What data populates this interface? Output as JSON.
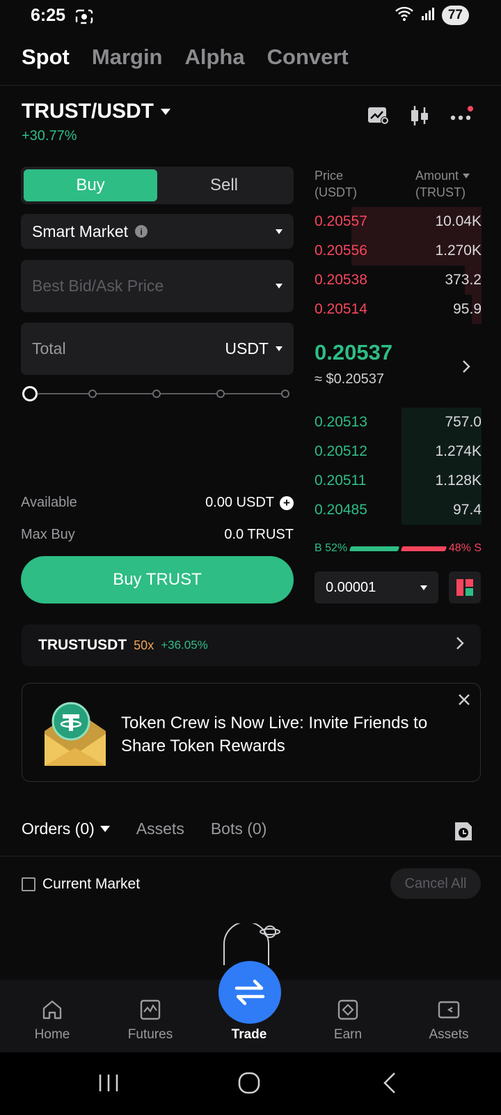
{
  "status": {
    "time": "6:25",
    "battery": "77"
  },
  "top_tabs": [
    "Spot",
    "Margin",
    "Alpha",
    "Convert"
  ],
  "pair": {
    "name": "TRUST/USDT",
    "change": "+30.77%"
  },
  "order_form": {
    "buy_label": "Buy",
    "sell_label": "Sell",
    "order_type": "Smart Market",
    "price_placeholder": "Best Bid/Ask Price",
    "total_label": "Total",
    "total_unit": "USDT",
    "available_label": "Available",
    "available_value": "0.00 USDT",
    "max_buy_label": "Max Buy",
    "max_buy_value": "0.0 TRUST",
    "submit_label": "Buy TRUST",
    "slider_percent": 0
  },
  "order_book": {
    "price_header": "Price",
    "price_unit": "(USDT)",
    "amount_header": "Amount",
    "amount_unit": "(TRUST)",
    "asks": [
      {
        "price": "0.20557",
        "amount": "10.04K",
        "depth": 0.78
      },
      {
        "price": "0.20556",
        "amount": "1.270K",
        "depth": 0.78
      },
      {
        "price": "0.20538",
        "amount": "373.2",
        "depth": 0.1
      },
      {
        "price": "0.20514",
        "amount": "95.9",
        "depth": 0.06
      }
    ],
    "last_price": "0.20537",
    "last_price_usd": "≈ $0.20537",
    "bids": [
      {
        "price": "0.20513",
        "amount": "757.0",
        "depth": 0.48
      },
      {
        "price": "0.20512",
        "amount": "1.274K",
        "depth": 0.48
      },
      {
        "price": "0.20511",
        "amount": "1.128K",
        "depth": 0.48
      },
      {
        "price": "0.20485",
        "amount": "97.4",
        "depth": 0.48
      }
    ],
    "buy_ratio": "B 52%",
    "sell_ratio": "48% S",
    "precision": "0.00001"
  },
  "futures_strip": {
    "symbol": "TRUSTUSDT",
    "leverage": "50x",
    "change": "+36.05%"
  },
  "banner": {
    "text": "Token Crew is Now Live: Invite Friends to Share Token Rewards"
  },
  "orders": {
    "tabs": [
      "Orders (0)",
      "Assets",
      "Bots (0)"
    ],
    "current_market_label": "Current Market",
    "cancel_all_label": "Cancel All"
  },
  "bottom_nav": [
    "Home",
    "Futures",
    "Trade",
    "Earn",
    "Assets"
  ],
  "colors": {
    "green": "#2ebd85",
    "red": "#f6465d",
    "blue": "#2f7cf6",
    "orange": "#f0a254"
  }
}
